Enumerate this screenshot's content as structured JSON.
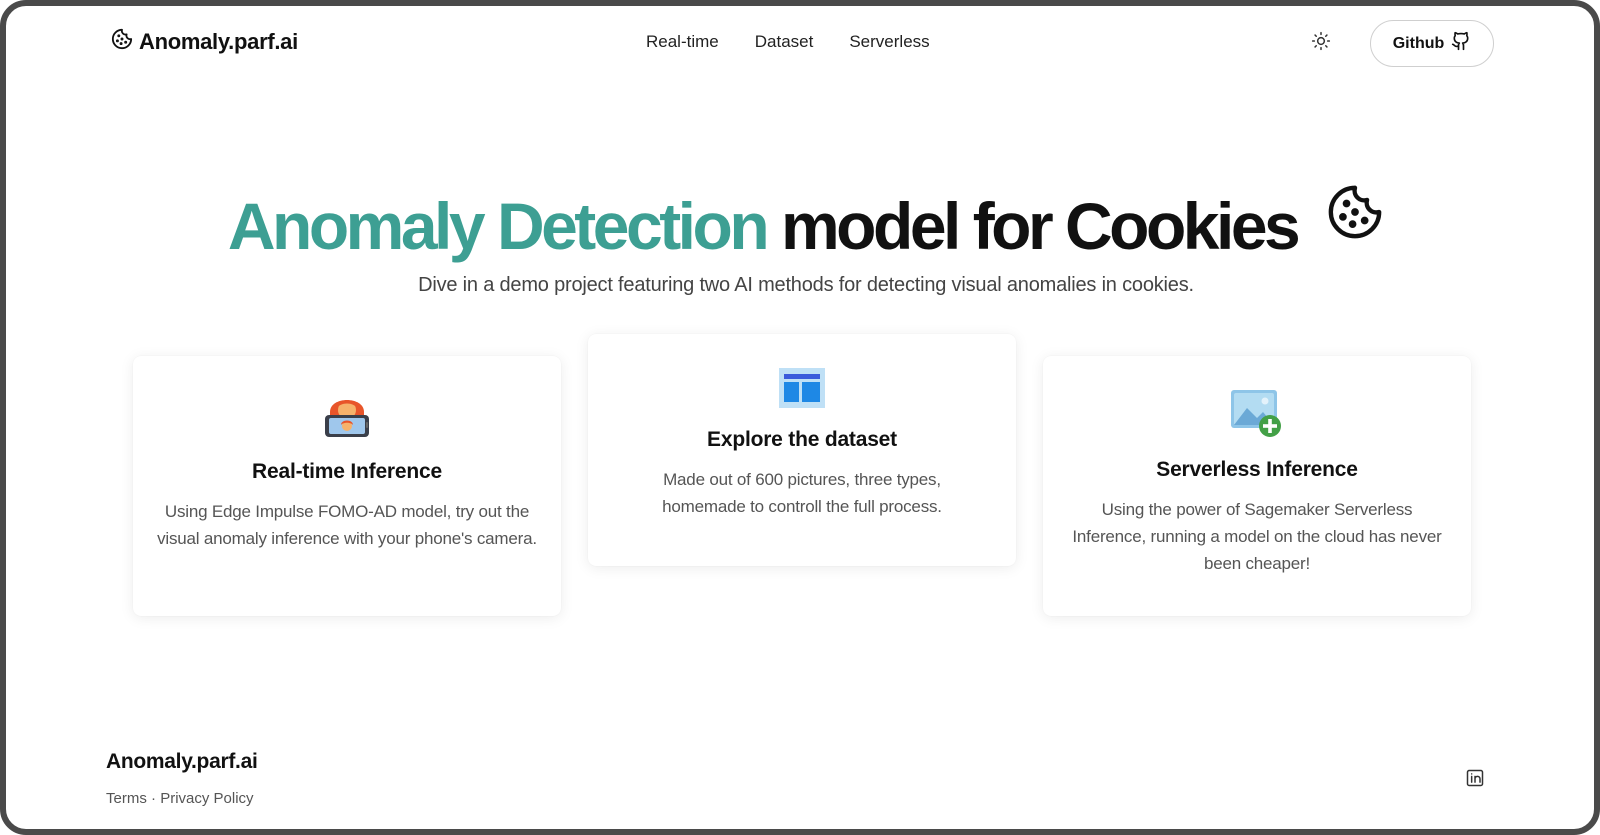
{
  "header": {
    "logo_text": "Anomaly.parf.ai",
    "nav": [
      "Real-time",
      "Dataset",
      "Serverless"
    ],
    "github_label": "Github"
  },
  "hero": {
    "title_accent": "Anomaly Detection",
    "title_rest": "model for Cookies",
    "subtitle": "Dive in a demo project featuring two AI methods for detecting visual anomalies in cookies."
  },
  "cards": [
    {
      "icon": "person-phone-icon",
      "title": "Real-time Inference",
      "description": "Using Edge Impulse FOMO-AD model, try out the visual anomaly inference with your phone's camera."
    },
    {
      "icon": "dataset-table-icon",
      "title": "Explore the dataset",
      "description": "Made out of 600 pictures, three types, homemade to controll the full process."
    },
    {
      "icon": "add-image-icon",
      "title": "Serverless Inference",
      "description": "Using the power of Sagemaker Serverless Inference, running a model on the cloud has never been cheaper!"
    }
  ],
  "footer": {
    "brand": "Anomaly.parf.ai",
    "terms": "Terms",
    "separator": "·",
    "privacy": "Privacy Policy"
  },
  "colors": {
    "accent": "#3d9f93",
    "text": "#111111",
    "muted": "#555555"
  }
}
